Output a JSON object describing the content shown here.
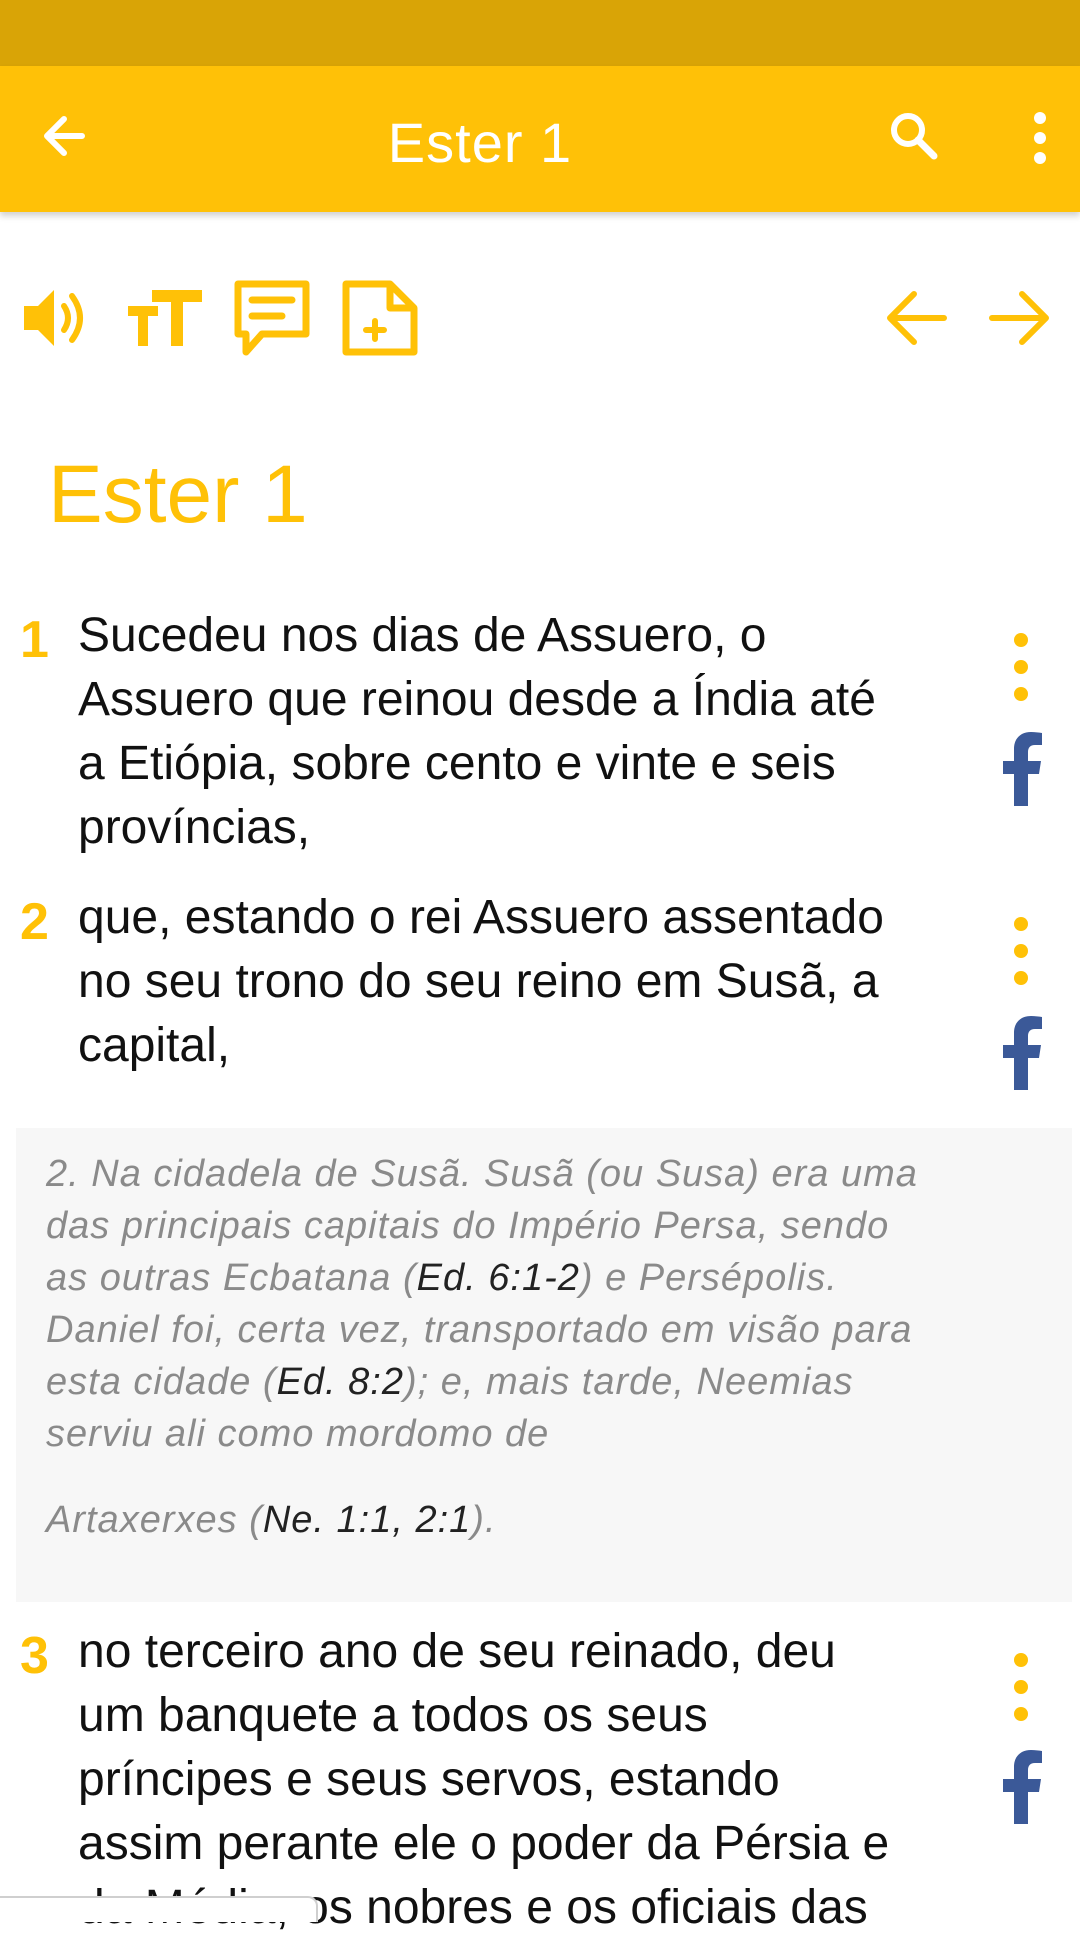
{
  "app_bar": {
    "title": "Ester 1"
  },
  "chapter": {
    "heading": "Ester 1"
  },
  "verses": [
    {
      "number": "1",
      "lines": [
        "Sucedeu nos dias de Assuero, o",
        "Assuero que reinou desde a Índia até",
        "a Etiópia, sobre cento e vinte e seis",
        "províncias,"
      ]
    },
    {
      "number": "2",
      "lines": [
        "que, estando o rei Assuero assentado",
        "no seu trono do seu reino em Susã, a",
        "capital,"
      ]
    },
    {
      "number": "3",
      "lines": [
        "no terceiro ano de seu reinado, deu",
        "um banquete a todos os seus",
        "príncipes e seus servos, estando",
        "assim perante ele o poder da Pérsia e",
        "da Média, os nobres e os oficiais das"
      ]
    }
  ],
  "note": {
    "l1": "2. Na cidadela de Susã. Susã (ou Susa) era uma",
    "l2": "das principais capitais do Império Persa, sendo",
    "l3_a": "as outras Ecbatana (",
    "l3_ref": "Ed. 6:1-2",
    "l3_b": ") e Persépolis.",
    "l4": "Daniel foi, certa vez, transportado em visão para",
    "l5_a": "esta cidade (",
    "l5_ref": "Ed. 8:2",
    "l5_b": "); e, mais tarde, Neemias",
    "l6": "serviu ali como mordomo de",
    "l7_a": "Artaxerxes (",
    "l7_ref": "Ne. 1:1, 2:1",
    "l7_b": ")."
  },
  "colors": {
    "accent": "#FFC107",
    "status_bar": "#D9A406",
    "facebook": "#3B5998",
    "note_bg": "#F7F7F7"
  },
  "icons": [
    "back-arrow-icon",
    "search-icon",
    "overflow-menu-icon",
    "speaker-icon",
    "text-size-icon",
    "comment-icon",
    "add-note-icon",
    "previous-chapter-icon",
    "next-chapter-icon",
    "verse-menu-icon",
    "facebook-icon"
  ]
}
